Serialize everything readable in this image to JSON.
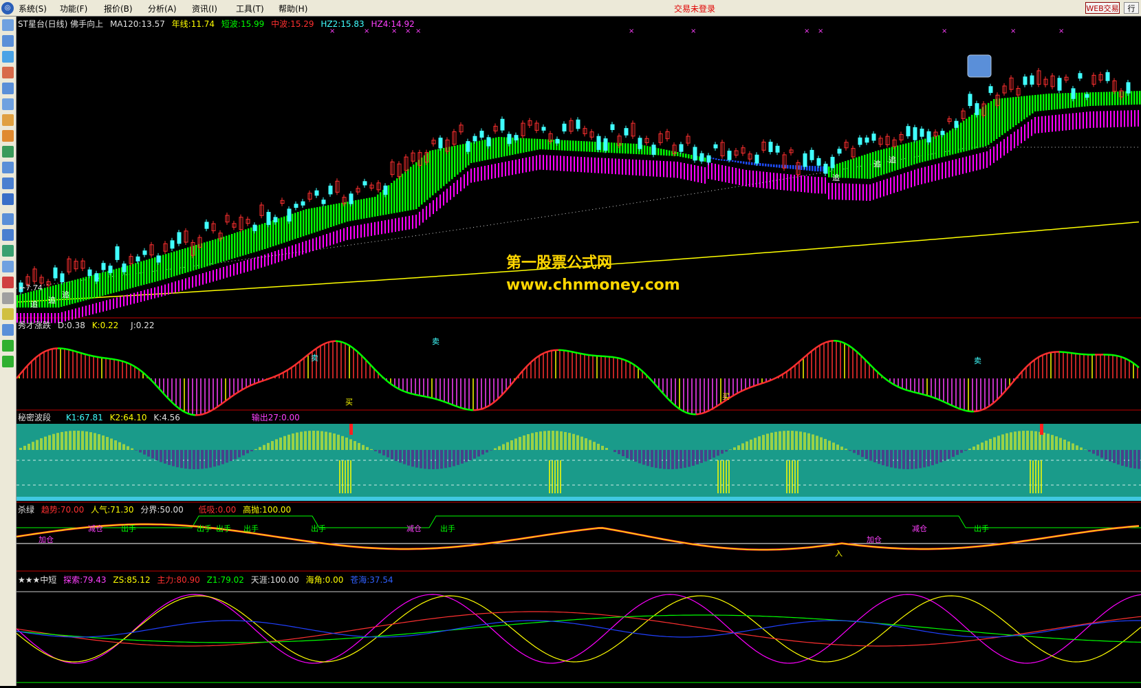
{
  "menubar": {
    "items": [
      "系统(S)",
      "功能(F)",
      "报价(B)",
      "分析(A)",
      "资讯(I)",
      "工具(T)",
      "帮助(H)"
    ],
    "status": "交易未登录",
    "web_trade": "WEB交易",
    "row_btn": "行"
  },
  "panel_main": {
    "title": "ST星台(日线) 佛手向上",
    "ma120": "MA120:13.57",
    "year_line": "年线:11.74",
    "short_wave": "短波:15.99",
    "mid_wave": "中波:15.29",
    "hz2": "HZ2:15.83",
    "hz4": "HZ4:14.92",
    "low_marker": "←7.74",
    "signal_chase": "追"
  },
  "panel_xiucai": {
    "title": "秀才涨跌",
    "d": "D:0.38",
    "k": "K:0.22",
    "j": "J:0.22",
    "buy": "买",
    "sell": "卖"
  },
  "panel_mimi": {
    "title": "秘密波段",
    "k1": "K1:67.81",
    "k2": "K2:64.10",
    "k": "K:4.56",
    "out": "输出27:0.00"
  },
  "panel_shalv": {
    "title": "杀绿",
    "trend": "趋势:70.00",
    "popularity": "人气:71.30",
    "boundary": "分界:50.00",
    "low_suck": "低吸:0.00",
    "high_throw": "高抛:100.00",
    "lbl_reduce": "减仓",
    "lbl_out": "出手",
    "lbl_add": "加仓",
    "lbl_in": "入"
  },
  "panel_zhongduan": {
    "title": "★★★中短",
    "explore": "探索:79.43",
    "zs": "ZS:85.12",
    "main_force": "主力:80.90",
    "z1": "Z1:79.02",
    "tianya": "天涯:100.00",
    "haijiao": "海角:0.00",
    "cangji": "苍海:37.54"
  },
  "watermark": {
    "cn": "第一股票公式网",
    "url": "www.chnmoney.com"
  },
  "colors": {
    "up": "#ff3030",
    "down": "#40ffff",
    "ribbon_green": "#00ff00",
    "ribbon_magenta": "#ff00ff",
    "ribbon_blue": "#1e4dff",
    "yellow": "#ffff00",
    "white": "#ffffff",
    "teal_bg": "#1a9b8a"
  }
}
